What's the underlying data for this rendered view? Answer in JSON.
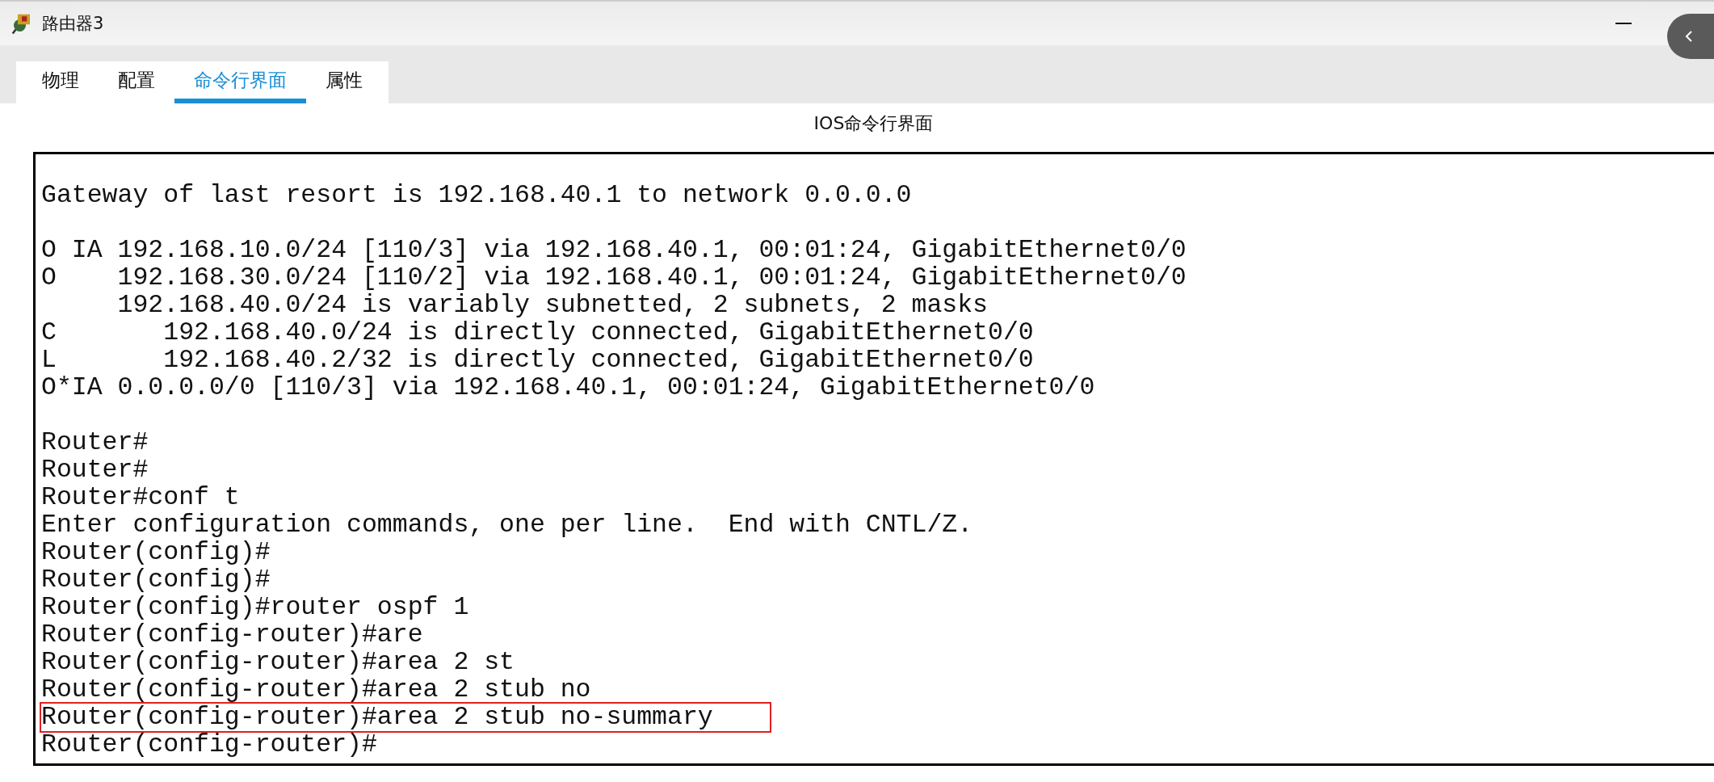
{
  "window": {
    "title": "路由器3"
  },
  "tabs": [
    {
      "label": "物理",
      "selected": false
    },
    {
      "label": "配置",
      "selected": false
    },
    {
      "label": "命令行界面",
      "selected": true
    },
    {
      "label": "属性",
      "selected": false
    }
  ],
  "panel_title": "IOS命令行界面",
  "terminal": {
    "blocks": [
      {
        "lines": [
          {
            "text": "Gateway of last resort is 192.168.40.1 to network 0.0.0.0",
            "highlighted": false
          }
        ]
      },
      {
        "lines": [
          {
            "text": "O IA 192.168.10.0/24 [110/3] via 192.168.40.1, 00:01:24, GigabitEthernet0/0",
            "highlighted": false
          },
          {
            "text": "O    192.168.30.0/24 [110/2] via 192.168.40.1, 00:01:24, GigabitEthernet0/0",
            "highlighted": false
          },
          {
            "text": "     192.168.40.0/24 is variably subnetted, 2 subnets, 2 masks",
            "highlighted": false
          },
          {
            "text": "C       192.168.40.0/24 is directly connected, GigabitEthernet0/0",
            "highlighted": false
          },
          {
            "text": "L       192.168.40.2/32 is directly connected, GigabitEthernet0/0",
            "highlighted": false
          },
          {
            "text": "O*IA 0.0.0.0/0 [110/3] via 192.168.40.1, 00:01:24, GigabitEthernet0/0",
            "highlighted": false
          }
        ]
      },
      {
        "lines": [
          {
            "text": "Router#",
            "highlighted": false
          },
          {
            "text": "Router#",
            "highlighted": false
          },
          {
            "text": "Router#conf t",
            "highlighted": false
          },
          {
            "text": "Enter configuration commands, one per line.  End with CNTL/Z.",
            "highlighted": false
          },
          {
            "text": "Router(config)#",
            "highlighted": false
          },
          {
            "text": "Router(config)#",
            "highlighted": false
          },
          {
            "text": "Router(config)#router ospf 1",
            "highlighted": false
          },
          {
            "text": "Router(config-router)#are",
            "highlighted": false
          },
          {
            "text": "Router(config-router)#area 2 st",
            "highlighted": false
          },
          {
            "text": "Router(config-router)#area 2 stub no",
            "highlighted": false
          },
          {
            "text": "Router(config-router)#area 2 stub no-summary",
            "highlighted": true
          },
          {
            "text": "Router(config-router)#",
            "highlighted": false
          }
        ]
      }
    ]
  }
}
